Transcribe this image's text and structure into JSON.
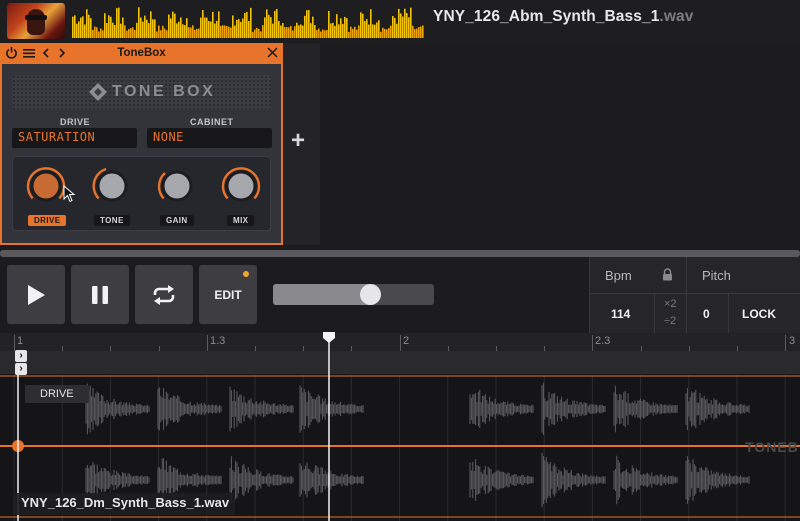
{
  "header": {
    "file_name": "YNY_126_Abm_Synth_Bass_1",
    "file_ext": ".wav"
  },
  "plugin": {
    "title": "ToneBox",
    "brand": "TONE BOX",
    "drive_section_label": "DRIVE",
    "cabinet_section_label": "CABINET",
    "drive_value": "SATURATION",
    "cabinet_value": "NONE",
    "knobs": [
      {
        "label": "DRIVE",
        "active": true
      },
      {
        "label": "TONE",
        "active": false
      },
      {
        "label": "GAIN",
        "active": false
      },
      {
        "label": "MIX",
        "active": false
      }
    ],
    "accent_color": "#e8742c"
  },
  "add_button": "+",
  "transport": {
    "edit_label": "EDIT",
    "slider_fraction": 0.62
  },
  "tempo": {
    "bpm_label": "Bpm",
    "pitch_label": "Pitch",
    "bpm_value": "114",
    "times_two": "×2",
    "div_two": "÷2",
    "pitch_value": "0",
    "lock_label": "LOCK"
  },
  "timeline": {
    "markers": [
      "1",
      "1.3",
      "2",
      "2.3",
      "3"
    ],
    "lane_label": "DRIVE",
    "watermark": "TONEB",
    "clip_name": "YNY_126_Dm_Synth_Bass_1.wav"
  },
  "icons": [
    "power-icon",
    "menu-icon",
    "chevron-left-icon",
    "chevron-right-icon",
    "close-icon",
    "play-icon",
    "pause-icon",
    "loop-icon",
    "lock-icon",
    "collapse-icon",
    "expand-icon"
  ]
}
